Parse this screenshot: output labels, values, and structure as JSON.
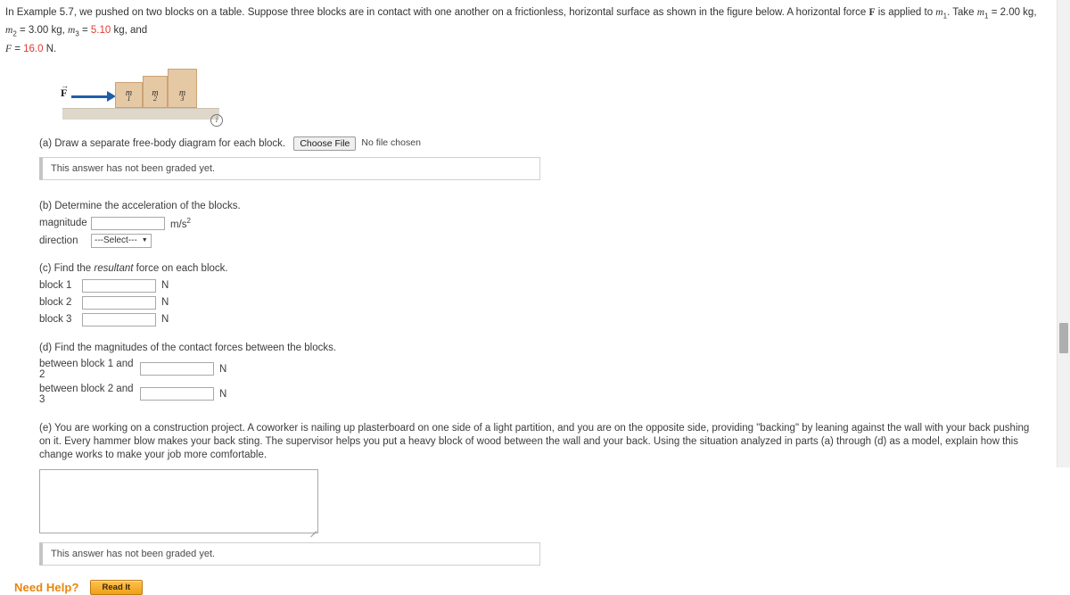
{
  "problem": {
    "intro_part1": "In Example 5.7, we pushed on two blocks on a table. Suppose three blocks are in contact with one another on a frictionless, horizontal surface as shown in the figure below. A horizontal force ",
    "force_symbol": "F",
    "intro_part2": " is applied to ",
    "m_sub1": "1",
    "intro_part3": ". Take ",
    "mass1_label": "m",
    "mass1_sub": "1",
    "mass1_value": " = 2.00 kg, ",
    "mass2_label": "m",
    "mass2_sub": "2",
    "mass2_value": " = 3.00 kg, ",
    "mass3_label": "m",
    "mass3_sub": "3",
    "mass3_eq": " = ",
    "mass3_value": "5.10",
    "mass3_unit": " kg, and",
    "force_label": "F",
    "force_eq": " = ",
    "force_value": "16.0",
    "force_unit": " N."
  },
  "figure": {
    "force_arrow_label": "F",
    "force_arrow_accent": "→",
    "block1_label": "m",
    "block1_sub": "1",
    "block2_label": "m",
    "block2_sub": "2",
    "block3_label": "m",
    "block3_sub": "3",
    "info_icon_glyph": "i",
    "block_color": "#e5c8a4",
    "block_border_color": "#caa274",
    "table_color": "#ded7ca",
    "arrow_color": "#1f5fa9"
  },
  "part_a": {
    "prompt": "(a) Draw a separate free-body diagram for each block.",
    "file_button_label": "Choose File",
    "file_status": "No file chosen",
    "grade_status": "This answer has not been graded yet."
  },
  "part_b": {
    "prompt": "(b) Determine the acceleration of the blocks.",
    "magnitude_label": "magnitude",
    "magnitude_value": "",
    "magnitude_unit": "m/s",
    "magnitude_unit_exp": "2",
    "direction_label": "direction",
    "direction_selected": "---Select---",
    "direction_caret": "▼"
  },
  "part_c": {
    "prompt_pre": "(c) Find the ",
    "prompt_italic": "resultant",
    "prompt_post": " force on each block.",
    "rows": [
      {
        "label": "block 1",
        "value": "",
        "unit": "N"
      },
      {
        "label": "block 2",
        "value": "",
        "unit": "N"
      },
      {
        "label": "block 3",
        "value": "",
        "unit": "N"
      }
    ]
  },
  "part_d": {
    "prompt": "(d) Find the magnitudes of the contact forces between the blocks.",
    "rows": [
      {
        "label": "between block 1 and 2",
        "value": "",
        "unit": "N"
      },
      {
        "label": "between block 2 and 3",
        "value": "",
        "unit": "N"
      }
    ]
  },
  "part_e": {
    "prompt": "(e) You are working on a construction project. A coworker is nailing up plasterboard on one side of a light partition, and you are on the opposite side, providing \"backing\" by leaning against the wall with your back pushing on it. Every hammer blow makes your back sting. The supervisor helps you put a heavy block of wood between the wall and your back. Using the situation analyzed in parts (a) through (d) as a model, explain how this change works to make your job more comfortable.",
    "answer_value": "",
    "grade_status": "This answer has not been graded yet."
  },
  "footer": {
    "need_help_label": "Need Help?",
    "read_it_label": "Read It",
    "accent_color": "#e8850c"
  }
}
